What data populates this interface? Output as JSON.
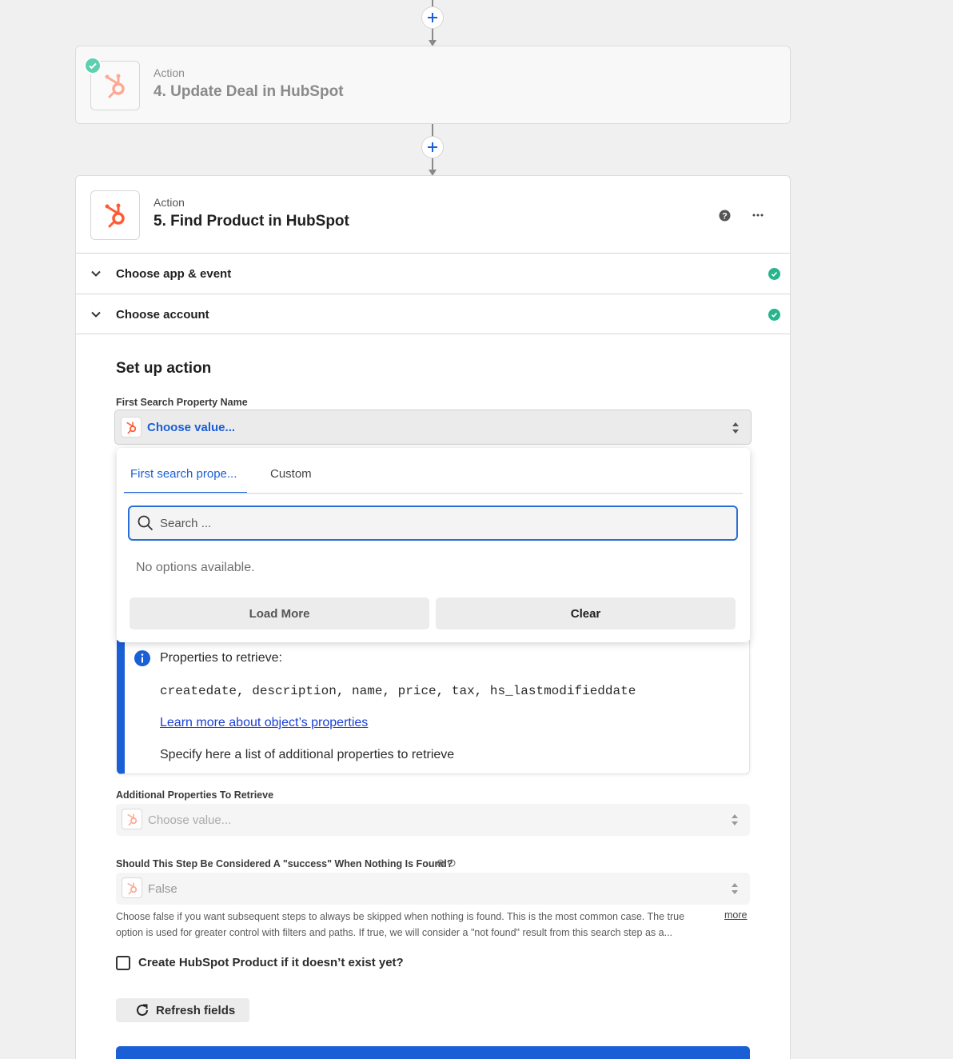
{
  "step4": {
    "kind": "Action",
    "title": "4. Update Deal in HubSpot"
  },
  "step5": {
    "kind": "Action",
    "title": "5. Find Product in HubSpot",
    "accordion": [
      {
        "label": "Choose app & event"
      },
      {
        "label": "Choose account"
      }
    ],
    "section_title": "Set up action"
  },
  "fields": {
    "first_search": {
      "label": "First Search Property Name",
      "placeholder": "Choose value..."
    },
    "additional": {
      "label": "Additional Properties To Retrieve",
      "placeholder": "Choose value..."
    },
    "success": {
      "label": "Should This Step Be Considered A \"success\" When Nothing Is Found?",
      "value": "False",
      "help": "Choose false if you want subsequent steps to always be skipped when nothing is found. This is the most common case. The true option is used for greater control with filters and paths. If true, we will consider a \"not found\" result from this search step as a...",
      "more": "more"
    },
    "create_checkbox_label": "Create HubSpot Product if it doesn’t exist yet?"
  },
  "dropdown": {
    "tabs": [
      "First search prope...",
      "Custom"
    ],
    "search_placeholder": "Search ...",
    "empty_text": "No options available.",
    "load_more": "Load More",
    "clear": "Clear"
  },
  "info": {
    "heading": "Properties to retrieve:",
    "properties": "createdate, description, name, price, tax, hs_lastmodifieddate",
    "link": "Learn more about object’s properties",
    "note": "Specify here a list of additional properties to retrieve"
  },
  "refresh_label": "Refresh fields",
  "icons": {
    "hubspot": "hubspot-icon",
    "plus": "plus-icon",
    "help": "question-circle-icon",
    "more": "ellipsis-icon",
    "check": "check-circle-icon",
    "chevron": "chevron-down-icon",
    "search": "search-icon",
    "info": "info-icon",
    "refresh": "refresh-icon"
  },
  "colors": {
    "accent": "#1a5fd6",
    "hubspot": "#ff5c35",
    "success": "#27b58e"
  }
}
